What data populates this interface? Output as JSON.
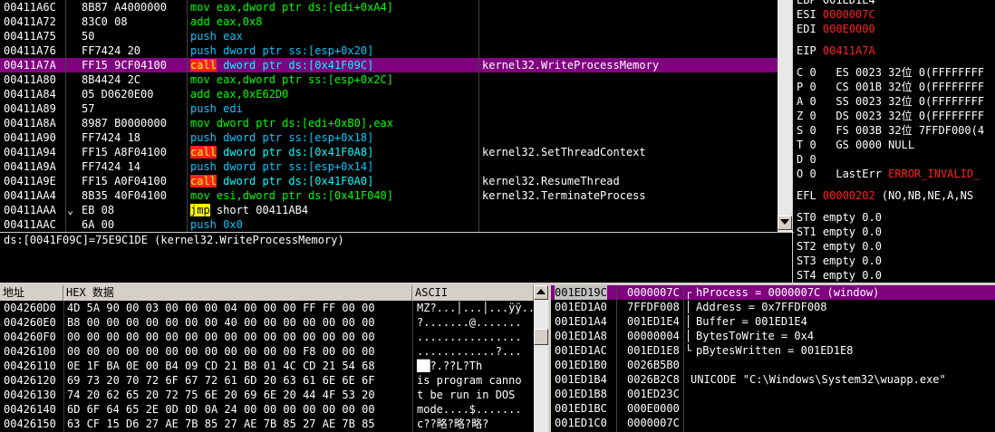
{
  "disasm": {
    "rows": [
      {
        "addr": "00411A6C",
        "hex": "8B87 A4000000",
        "mn": "mov",
        "ops": " eax,dword ptr ds:[edi+0xA4]",
        "cls": "green",
        "cmt": ""
      },
      {
        "addr": "00411A72",
        "hex": "83C0 08",
        "mn": "add",
        "ops": " eax,0x8",
        "cls": "green",
        "cmt": ""
      },
      {
        "addr": "00411A75",
        "hex": "50",
        "mn": "push",
        "ops": " eax",
        "cls": "blue",
        "cmt": ""
      },
      {
        "addr": "00411A76",
        "hex": "FF7424 20",
        "mn": "push",
        "ops": " dword ptr ss:[esp+0x20]",
        "cls": "blue",
        "cmt": ""
      },
      {
        "addr": "00411A7A",
        "hex": "FF15 9CF04100",
        "mn": "call",
        "ops": " dword ptr ds:[0x41F09C]",
        "cls": "call",
        "cmt": "kernel32.WriteProcessMemory",
        "selected": true
      },
      {
        "addr": "00411A80",
        "hex": "8B4424 2C",
        "mn": "mov",
        "ops": " eax,dword ptr ss:[esp+0x2C]",
        "cls": "green",
        "cmt": ""
      },
      {
        "addr": "00411A84",
        "hex": "05 D0620E00",
        "mn": "add",
        "ops": " eax,0xE62D0",
        "cls": "green",
        "cmt": ""
      },
      {
        "addr": "00411A89",
        "hex": "57",
        "mn": "push",
        "ops": " edi",
        "cls": "blue",
        "cmt": ""
      },
      {
        "addr": "00411A8A",
        "hex": "8987 B0000000",
        "mn": "mov",
        "ops": " dword ptr ds:[edi+0xB0],eax",
        "cls": "green",
        "cmt": ""
      },
      {
        "addr": "00411A90",
        "hex": "FF7424 18",
        "mn": "push",
        "ops": " dword ptr ss:[esp+0x18]",
        "cls": "blue",
        "cmt": ""
      },
      {
        "addr": "00411A94",
        "hex": "FF15 A8F04100",
        "mn": "call",
        "ops": " dword ptr ds:[0x41F0A8]",
        "cls": "call",
        "cmt": "kernel32.SetThreadContext"
      },
      {
        "addr": "00411A9A",
        "hex": "FF7424 14",
        "mn": "push",
        "ops": " dword ptr ss:[esp+0x14]",
        "cls": "blue",
        "cmt": ""
      },
      {
        "addr": "00411A9E",
        "hex": "FF15 A0F04100",
        "mn": "call",
        "ops": " dword ptr ds:[0x41F0A0]",
        "cls": "call",
        "cmt": "kernel32.ResumeThread"
      },
      {
        "addr": "00411AA4",
        "hex": "8B35 40F04100",
        "mn": "mov",
        "ops": " esi,dword ptr ds:[0x41F040]",
        "cls": "green",
        "cmt": "kernel32.TerminateProcess"
      },
      {
        "addr": "00411AAA",
        "hex": "EB 08",
        "mn": "jmp",
        "ops": " short 00411AB4",
        "cls": "jmp",
        "cmt": "",
        "jumpmark": "⌄"
      },
      {
        "addr": "00411AAC",
        "hex": "6A 00",
        "mn": "push",
        "ops": " 0x0",
        "cls": "blue",
        "cmt": ""
      }
    ]
  },
  "info_line": "ds:[0041F09C]=75E9C1DE (kernel32.WriteProcessMemory)",
  "registers": {
    "lines": [
      {
        "t": "EBP 001ED1E4",
        "part": true
      },
      {
        "label": "ESI",
        "val": "0000007C"
      },
      {
        "label": "EDI",
        "val": "000E0000"
      },
      {
        "gap": true
      },
      {
        "label": "EIP",
        "val": "00411A7A"
      },
      {
        "gap": true
      },
      {
        "t": "C 0   ES 0023 32位 0(FFFFFFFF"
      },
      {
        "t": "P 0   CS 001B 32位 0(FFFFFFFF"
      },
      {
        "t": "A 0   SS 0023 32位 0(FFFFFFFF"
      },
      {
        "t": "Z 0   DS 0023 32位 0(FFFFFFFF"
      },
      {
        "t": "S 0   FS 003B 32位 7FFDF000(4"
      },
      {
        "t": "T 0   GS 0000 NULL"
      },
      {
        "t": "D 0"
      },
      {
        "t": "O 0   LastErr ",
        "err": "ERROR_INVALID_"
      },
      {
        "gap": true
      },
      {
        "t": "EFL ",
        "efl": "00000202",
        "rest": " (NO,NB,NE,A,NS"
      },
      {
        "gap": true
      },
      {
        "t": "ST0 empty 0.0"
      },
      {
        "t": "ST1 empty 0.0"
      },
      {
        "t": "ST2 empty 0.0"
      },
      {
        "t": "ST3 empty 0.0"
      },
      {
        "t": "ST4 empty 0.0"
      }
    ]
  },
  "dump": {
    "headers": {
      "addr": "地址",
      "hex": "HEX 数据",
      "ascii": "ASCII"
    },
    "rows": [
      {
        "a": "004260D0",
        "h": "4D 5A 90 00 03 00 00 00 04 00 00 00 FF FF 00 00",
        "c": "MZ?...│...│...ÿÿ.."
      },
      {
        "a": "004260E0",
        "h": "B8 00 00 00 00 00 00 00 40 00 00 00 00 00 00 00",
        "c": "?.......@......."
      },
      {
        "a": "004260F0",
        "h": "00 00 00 00 00 00 00 00 00 00 00 00 00 00 00 00",
        "c": "................"
      },
      {
        "a": "00426100",
        "h": "00 00 00 00 00 00 00 00 00 00 00 00 F8 00 00 00",
        "c": "............?..."
      },
      {
        "a": "00426110",
        "h": "0E 1F BA 0E 00 B4 09 CD 21 B8 01 4C CD 21 54 68",
        "c": "██?.??L?Th"
      },
      {
        "a": "00426120",
        "h": "69 73 20 70 72 6F 67 72 61 6D 20 63 61 6E 6E 6F",
        "c": "is program canno"
      },
      {
        "a": "00426130",
        "h": "74 20 62 65 20 72 75 6E 20 69 6E 20 44 4F 53 20",
        "c": "t be run in DOS "
      },
      {
        "a": "00426140",
        "h": "6D 6F 64 65 2E 0D 0D 0A 24 00 00 00 00 00 00 00",
        "c": "mode....$......."
      },
      {
        "a": "00426150",
        "h": "63 CF 15 D6 27 AE 7B 85 27 AE 7B 85 27 AE 7B 85",
        "c": "c??略?略?略?"
      }
    ]
  },
  "stack": {
    "rows": [
      {
        "a": "001ED19C",
        "v": "0000007C",
        "c": "hProcess = 0000007C (window)",
        "sel": true,
        "br": "┌"
      },
      {
        "a": "001ED1A0",
        "v": "7FFDF008",
        "c": "Address = 0x7FFDF008",
        "br": "│"
      },
      {
        "a": "001ED1A4",
        "v": "001ED1E4",
        "c": "Buffer = 001ED1E4",
        "br": "│"
      },
      {
        "a": "001ED1A8",
        "v": "00000004",
        "c": "BytesToWrite = 0x4",
        "br": "│"
      },
      {
        "a": "001ED1AC",
        "v": "001ED1E8",
        "c": "pBytesWritten = 001ED1E8",
        "br": "└"
      },
      {
        "a": "001ED1B0",
        "v": "0026B5B0",
        "c": "",
        "br": ""
      },
      {
        "a": "001ED1B4",
        "v": "0026B2C8",
        "c": "UNICODE \"C:\\Windows\\System32\\wuapp.exe\"",
        "br": ""
      },
      {
        "a": "001ED1B8",
        "v": "001ED23C",
        "c": "",
        "br": ""
      },
      {
        "a": "001ED1BC",
        "v": "000E0000",
        "c": "",
        "br": ""
      },
      {
        "a": "001ED1C0",
        "v": "0000007C",
        "c": "",
        "br": ""
      }
    ]
  }
}
